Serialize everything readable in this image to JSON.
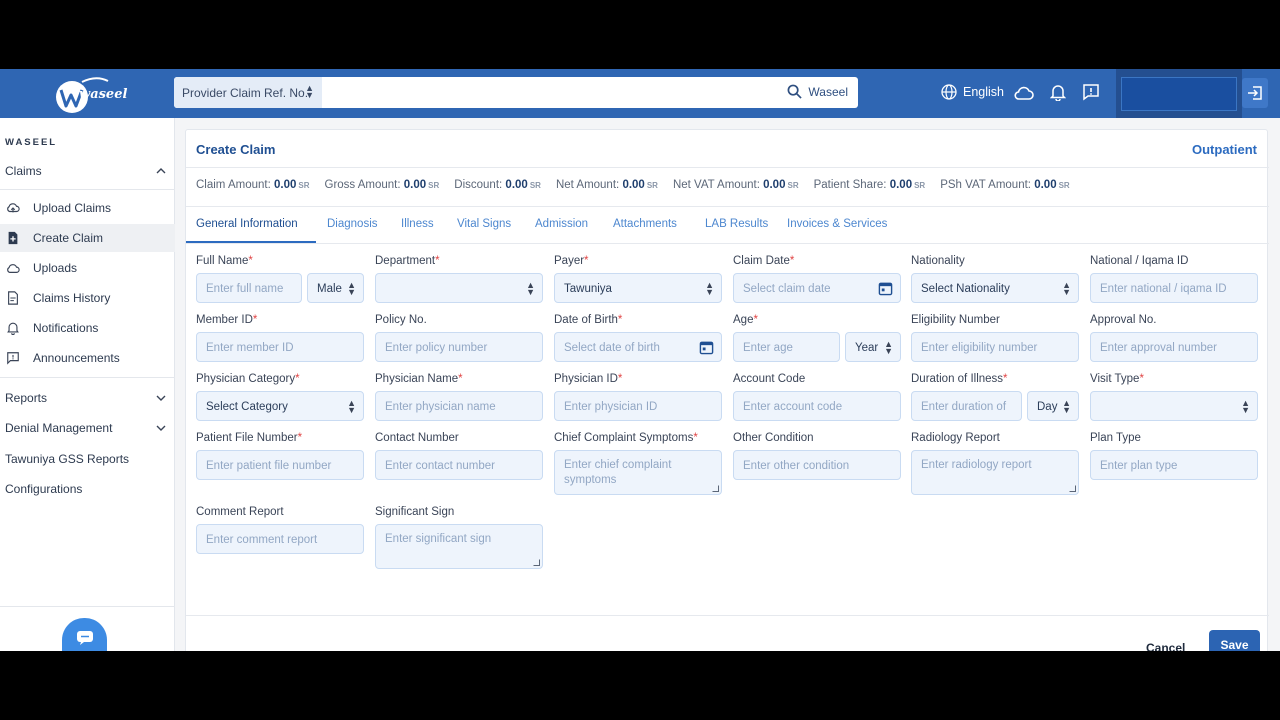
{
  "header": {
    "logo_text": "waseel",
    "search_select_label": "Provider Claim Ref. No.",
    "search_button_label": "Waseel",
    "language_label": "English"
  },
  "sidebar": {
    "brand": "WASEEL",
    "claims_section": "Claims",
    "items": [
      {
        "label": "Upload Claims",
        "icon": "cloud-upload-icon"
      },
      {
        "label": "Create Claim",
        "icon": "file-add-icon"
      },
      {
        "label": "Uploads",
        "icon": "cloud-icon"
      },
      {
        "label": "Claims History",
        "icon": "document-icon"
      },
      {
        "label": "Notifications",
        "icon": "bell-icon"
      },
      {
        "label": "Announcements",
        "icon": "message-icon"
      }
    ],
    "reports": "Reports",
    "denial_management": "Denial Management",
    "tawuniya_gss": "Tawuniya GSS Reports",
    "configurations": "Configurations"
  },
  "claim": {
    "title": "Create Claim",
    "type": "Outpatient",
    "currency": "SR",
    "amounts": [
      {
        "label": "Claim Amount:",
        "value": "0.00"
      },
      {
        "label": "Gross Amount:",
        "value": "0.00"
      },
      {
        "label": "Discount:",
        "value": "0.00"
      },
      {
        "label": "Net Amount:",
        "value": "0.00"
      },
      {
        "label": "Net VAT Amount:",
        "value": "0.00"
      },
      {
        "label": "Patient Share:",
        "value": "0.00"
      },
      {
        "label": "PSh VAT Amount:",
        "value": "0.00"
      }
    ],
    "tabs": [
      "General Information",
      "Diagnosis",
      "Illness",
      "Vital Signs",
      "Admission",
      "Attachments",
      "LAB Results",
      "Invoices & Services"
    ]
  },
  "form": {
    "full_name": {
      "label": "Full Name",
      "placeholder": "Enter full name"
    },
    "gender": {
      "value": "Male"
    },
    "department": {
      "label": "Department",
      "value": ""
    },
    "payer": {
      "label": "Payer",
      "value": "Tawuniya"
    },
    "claim_date": {
      "label": "Claim Date",
      "placeholder": "Select claim date"
    },
    "nationality": {
      "label": "Nationality",
      "value": "Select Nationality"
    },
    "national_id": {
      "label": "National / Iqama ID",
      "placeholder": "Enter national / iqama ID"
    },
    "member_id": {
      "label": "Member ID",
      "placeholder": "Enter member ID"
    },
    "policy_no": {
      "label": "Policy No.",
      "placeholder": "Enter policy number"
    },
    "dob": {
      "label": "Date of Birth",
      "placeholder": "Select date of birth"
    },
    "age": {
      "label": "Age",
      "placeholder": "Enter age",
      "unit": "Year"
    },
    "eligibility": {
      "label": "Eligibility Number",
      "placeholder": "Enter eligibility number"
    },
    "approval": {
      "label": "Approval No.",
      "placeholder": "Enter approval number"
    },
    "physician_category": {
      "label": "Physician Category",
      "value": "Select Category"
    },
    "physician_name": {
      "label": "Physician Name",
      "placeholder": "Enter physician name"
    },
    "physician_id": {
      "label": "Physician ID",
      "placeholder": "Enter physician ID"
    },
    "account_code": {
      "label": "Account Code",
      "placeholder": "Enter account code"
    },
    "illness_duration": {
      "label": "Duration of Illness",
      "placeholder": "Enter duration of",
      "unit": "Day"
    },
    "visit_type": {
      "label": "Visit Type",
      "value": ""
    },
    "patient_file": {
      "label": "Patient File Number",
      "placeholder": "Enter patient file number"
    },
    "contact": {
      "label": "Contact Number",
      "placeholder": "Enter contact number"
    },
    "chief_complaint": {
      "label": "Chief Complaint Symptoms",
      "placeholder": "Enter chief complaint symptoms"
    },
    "other_condition": {
      "label": "Other Condition",
      "placeholder": "Enter other condition"
    },
    "radiology": {
      "label": "Radiology Report",
      "placeholder": "Enter radiology report"
    },
    "plan_type": {
      "label": "Plan Type",
      "placeholder": "Enter plan type"
    },
    "comment": {
      "label": "Comment Report",
      "placeholder": "Enter comment report"
    },
    "significant_sign": {
      "label": "Significant Sign",
      "placeholder": "Enter significant sign"
    }
  },
  "actions": {
    "cancel": "Cancel",
    "save": "Save"
  }
}
